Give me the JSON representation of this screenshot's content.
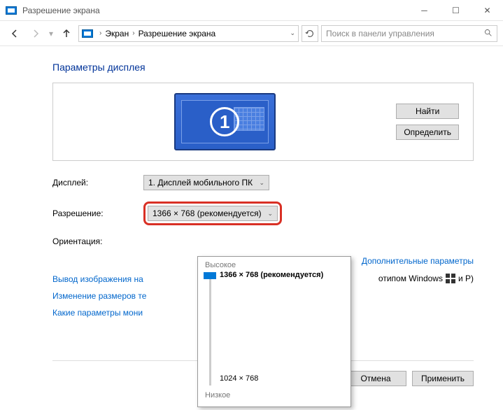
{
  "window": {
    "title": "Разрешение экрана"
  },
  "breadcrumb": {
    "item1": "Экран",
    "item2": "Разрешение экрана"
  },
  "search": {
    "placeholder": "Поиск в панели управления"
  },
  "heading": "Параметры дисплея",
  "buttons": {
    "find": "Найти",
    "detect": "Определить",
    "cancel": "Отмена",
    "apply": "Применить"
  },
  "monitor_number": "1",
  "labels": {
    "display": "Дисплей:",
    "resolution": "Разрешение:",
    "orientation": "Ориентация:"
  },
  "selects": {
    "display": "1. Дисплей мобильного ПК",
    "resolution": "1366 × 768 (рекомендуется)"
  },
  "popup": {
    "high": "Высокое",
    "low": "Низкое",
    "options": {
      "top": "1366 × 768 (рекомендуется)",
      "bottom": "1024 × 768"
    }
  },
  "links": {
    "advanced": "Дополнительные параметры",
    "projector_prefix": "Вывод изображения на",
    "projector_suffix_left": "отипом Windows",
    "projector_suffix_right": "и P)",
    "textsize": "Изменение размеров те",
    "which": "Какие параметры мони"
  }
}
